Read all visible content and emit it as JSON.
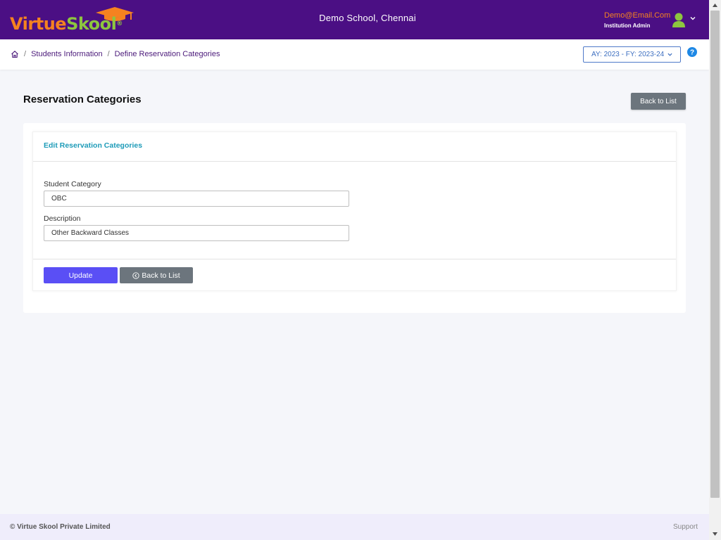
{
  "header": {
    "logo_virtue": "Virtue",
    "logo_skool": "Skool",
    "logo_reg": "®",
    "school_name": "Demo School, Chennai",
    "user_email": "Demo@Email.Com",
    "user_role": "Institution Admin",
    "colors": {
      "bg": "#4b0f84",
      "orange": "#f58220",
      "green": "#8dc63f"
    }
  },
  "breadcrumb": {
    "home_icon": "home-icon",
    "items": [
      "Students Information",
      "Define Reservation Categories"
    ],
    "separator": "/"
  },
  "year_select": {
    "value": "AY: 2023 - FY: 2023-24"
  },
  "help_icon": "?",
  "page": {
    "title": "Reservation Categories",
    "back_to_list": "Back to List"
  },
  "form": {
    "card_title": "Edit Reservation Categories",
    "fields": [
      {
        "label": "Student Category",
        "value": "OBC"
      },
      {
        "label": "Description",
        "value": "Other Backward Classes"
      }
    ],
    "update_label": "Update",
    "back_label": "Back to List"
  },
  "footer": {
    "copyright": "© Virtue Skool Private Limited",
    "support": "Support"
  }
}
